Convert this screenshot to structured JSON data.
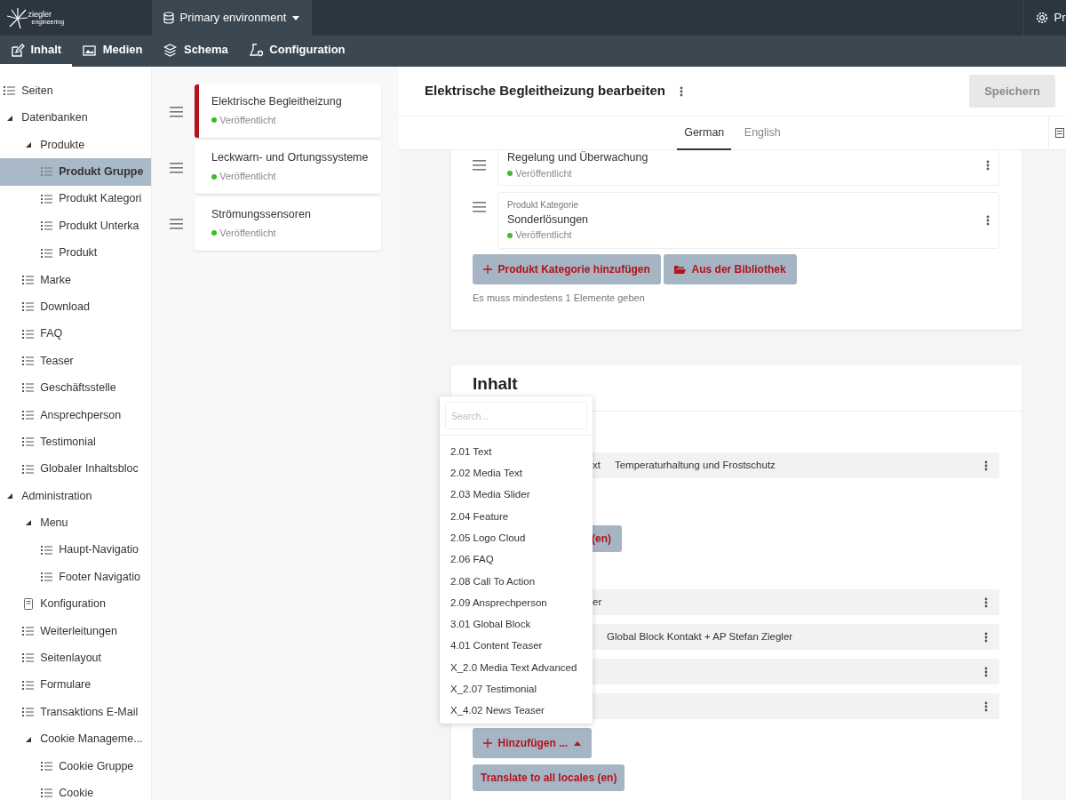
{
  "logo": {
    "name": "ziegler",
    "tagline": "engineering"
  },
  "environment": {
    "label": "Primary environment"
  },
  "user_menu": {
    "label": "Pr"
  },
  "nav_tabs": [
    {
      "label": "Inhalt",
      "selected": true
    },
    {
      "label": "Medien",
      "selected": false
    },
    {
      "label": "Schema",
      "selected": false
    },
    {
      "label": "Configuration",
      "selected": false
    }
  ],
  "sidebar": {
    "items": [
      {
        "label": "Seiten",
        "kind": "list",
        "selected": false
      },
      {
        "label": "Datenbanken",
        "expanded": true,
        "children": [
          {
            "label": "Produkte",
            "expanded": true,
            "children": [
              {
                "label": "Produkt Gruppe",
                "kind": "list",
                "selected": true
              },
              {
                "label": "Produkt Kategori",
                "kind": "list",
                "selected": false
              },
              {
                "label": "Produkt Unterka",
                "kind": "list",
                "selected": false
              },
              {
                "label": "Produkt",
                "kind": "list",
                "selected": false
              }
            ]
          },
          {
            "label": "Marke",
            "kind": "list",
            "selected": false
          },
          {
            "label": "Download",
            "kind": "list",
            "selected": false
          },
          {
            "label": "FAQ",
            "kind": "list",
            "selected": false
          },
          {
            "label": "Teaser",
            "kind": "list",
            "selected": false
          },
          {
            "label": "Geschäftsstelle",
            "kind": "list",
            "selected": false
          },
          {
            "label": "Ansprechperson",
            "kind": "list",
            "selected": false
          },
          {
            "label": "Testimonial",
            "kind": "list",
            "selected": false
          },
          {
            "label": "Globaler Inhaltsbloc",
            "kind": "list",
            "selected": false
          }
        ]
      },
      {
        "label": "Administration",
        "expanded": true,
        "children": [
          {
            "label": "Menu",
            "expanded": true,
            "children": [
              {
                "label": "Haupt-Navigatio",
                "kind": "list",
                "selected": false
              },
              {
                "label": "Footer Navigatio",
                "kind": "list",
                "selected": false
              }
            ]
          },
          {
            "label": "Konfiguration",
            "kind": "doc",
            "selected": false
          },
          {
            "label": "Weiterleitungen",
            "kind": "list",
            "selected": false
          },
          {
            "label": "Seitenlayout",
            "kind": "list",
            "selected": false
          },
          {
            "label": "Formulare",
            "kind": "list",
            "selected": false
          },
          {
            "label": "Transaktions E-Mail",
            "kind": "list",
            "selected": false
          },
          {
            "label": "Cookie Manageme...",
            "expanded": true,
            "children": [
              {
                "label": "Cookie Gruppe",
                "kind": "list",
                "selected": false
              },
              {
                "label": "Cookie",
                "kind": "list",
                "selected": false
              }
            ]
          }
        ]
      }
    ]
  },
  "content_list": [
    {
      "title": "Elektrische Begleitheizung",
      "status": "Veröffentlicht",
      "selected": true
    },
    {
      "title": "Leckwarn- und Ortungssysteme",
      "status": "Veröffentlicht",
      "selected": false
    },
    {
      "title": "Strömungssensoren",
      "status": "Veröffentlicht",
      "selected": false
    }
  ],
  "editor": {
    "title": "Elektrische Begleitheizung bearbeiten",
    "save_button": {
      "label": "Speichern",
      "disabled": true
    },
    "language_tabs": [
      {
        "label": "German",
        "selected": true
      },
      {
        "label": "English",
        "selected": false
      }
    ],
    "categories": {
      "items": [
        {
          "title": "Regelung und Überwachung",
          "status": "Veröffentlicht"
        },
        {
          "type": "Produkt Kategorie",
          "title": "Sonderlösungen",
          "status": "Veröffentlicht"
        }
      ],
      "add_button": "Produkt Kategorie hinzufügen",
      "library_button": "Aus der Bibliothek",
      "hint": "Es muss mindestens 1 Elemente geben"
    },
    "content": {
      "heading": "Inhalt",
      "blocks_a": [
        {
          "kind": "block",
          "type": "xt",
          "title": "Temperaturhaltung und Frostschutz"
        }
      ],
      "translate_partial": "(en)",
      "blocks_b": [
        {
          "kind": "block",
          "type": "er"
        },
        {
          "kind": "block",
          "title": "Global Block Kontakt + AP Stefan Ziegler"
        },
        {
          "kind": "block"
        },
        {
          "kind": "block"
        }
      ],
      "add_button": "Hinzufügen ...",
      "translate_button": "Translate to all locales (en)",
      "dropdown": {
        "placeholder": "Search...",
        "options": [
          "2.01 Text",
          "2.02 Media Text",
          "2.03 Media Slider",
          "2.04 Feature",
          "2.05 Logo Cloud",
          "2.06 FAQ",
          "2.08 Call To Action",
          "2.09 Ansprechperson",
          "3.01 Global Block",
          "4.01 Content Teaser",
          "X_2.0 Media Text Advanced",
          "X_2.07 Testimonial",
          "X_4.02 News Teaser"
        ]
      }
    }
  }
}
